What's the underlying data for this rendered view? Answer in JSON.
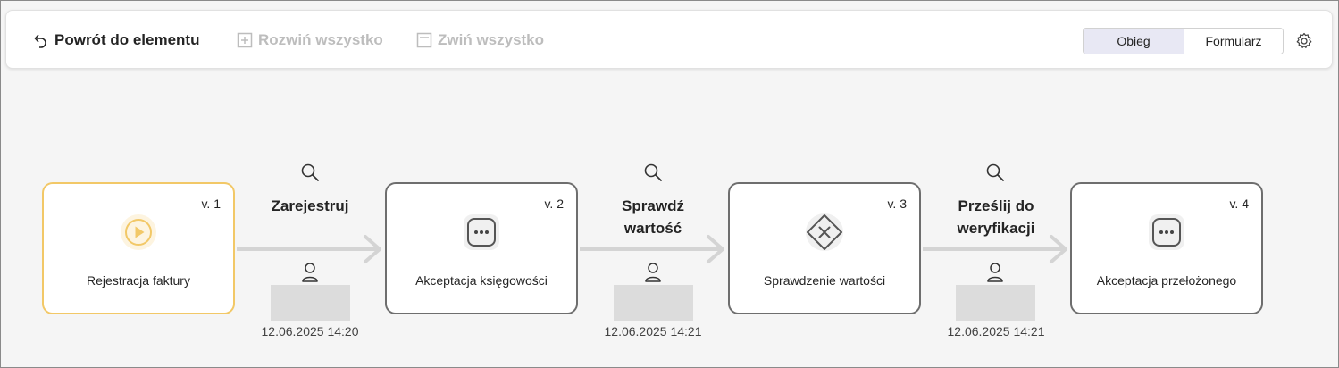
{
  "toolbar": {
    "back_label": "Powrót do elementu",
    "expand_label": "Rozwiń wszystko",
    "collapse_label": "Zwiń wszystko",
    "view_tabs": [
      {
        "label": "Obieg",
        "active": true
      },
      {
        "label": "Formularz",
        "active": false
      }
    ],
    "settings_icon": "gear-icon"
  },
  "workflow": {
    "steps": [
      {
        "version": "v. 1",
        "label": "Rejestracja faktury",
        "icon": "play-icon",
        "state": "start",
        "color": "#f2c867"
      },
      {
        "version": "v. 2",
        "label": "Akceptacja księgowości",
        "icon": "more-icon",
        "state": "pending"
      },
      {
        "version": "v. 3",
        "label": "Sprawdzenie wartości",
        "icon": "decision-icon",
        "state": "condition"
      },
      {
        "version": "v. 4",
        "label": "Akceptacja przełożonego",
        "icon": "more-icon",
        "state": "pending"
      }
    ],
    "transitions": [
      {
        "title_line1": "Zarejestruj",
        "title_line2": "",
        "timestamp": "12.06.2025 14:20",
        "user": "[blurred]"
      },
      {
        "title_line1": "Sprawdź",
        "title_line2": "wartość",
        "timestamp": "12.06.2025 14:21",
        "user": "[blurred]"
      },
      {
        "title_line1": "Prześlij do",
        "title_line2": "weryfikacji",
        "timestamp": "12.06.2025 14:21",
        "user": "[blurred]"
      }
    ]
  },
  "colors": {
    "start_accent": "#f2c867",
    "node_border": "#6e6e6e",
    "connector": "#d4d4d4",
    "active_tab": "#e8e8f4"
  }
}
